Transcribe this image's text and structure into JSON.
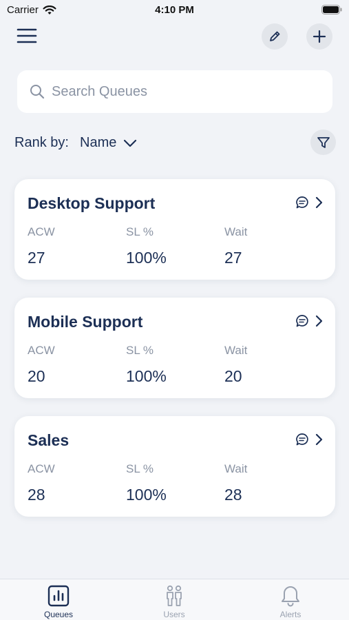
{
  "status_bar": {
    "carrier": "Carrier",
    "time": "4:10 PM"
  },
  "toolbar": {
    "menu_icon": "hamburger-icon",
    "edit_icon": "pencil-icon",
    "add_icon": "plus-icon"
  },
  "search": {
    "placeholder": "Search Queues",
    "value": ""
  },
  "rank": {
    "label": "Rank by:",
    "selected": "Name"
  },
  "queues": [
    {
      "name": "Desktop Support",
      "acw_label": "ACW",
      "acw": "27",
      "sl_label": "SL %",
      "sl": "100%",
      "wait_label": "Wait",
      "wait": "27"
    },
    {
      "name": "Mobile Support",
      "acw_label": "ACW",
      "acw": "20",
      "sl_label": "SL %",
      "sl": "100%",
      "wait_label": "Wait",
      "wait": "20"
    },
    {
      "name": "Sales",
      "acw_label": "ACW",
      "acw": "28",
      "sl_label": "SL %",
      "sl": "100%",
      "wait_label": "Wait",
      "wait": "28"
    }
  ],
  "tabs": [
    {
      "label": "Queues",
      "icon": "bar-chart-icon",
      "active": true
    },
    {
      "label": "Users",
      "icon": "users-icon",
      "active": false
    },
    {
      "label": "Alerts",
      "icon": "bell-icon",
      "active": false
    }
  ],
  "colors": {
    "primary": "#1c2f55",
    "muted": "#8a93a3",
    "background": "#f1f3f7",
    "card": "#ffffff"
  }
}
